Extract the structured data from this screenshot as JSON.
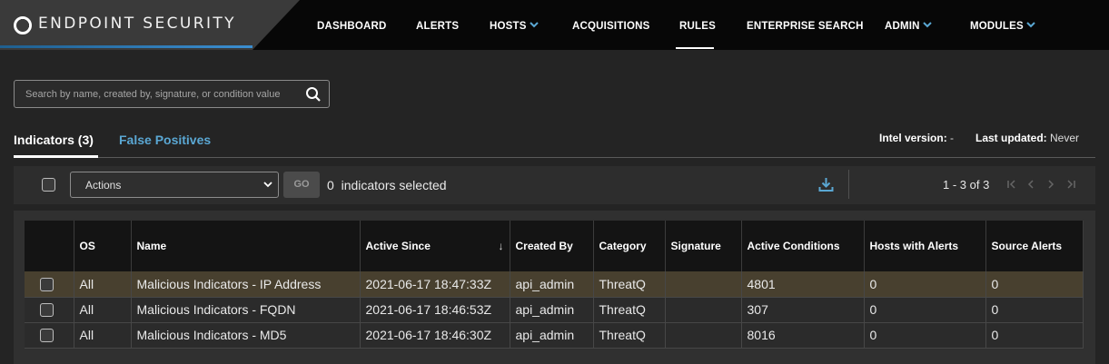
{
  "app": {
    "logo_text": "ENDPOINT SECURITY"
  },
  "nav": {
    "items": [
      {
        "label": "DASHBOARD",
        "dropdown": false
      },
      {
        "label": "ALERTS",
        "dropdown": false
      },
      {
        "label": "HOSTS",
        "dropdown": true
      },
      {
        "label": "ACQUISITIONS",
        "dropdown": false
      },
      {
        "label": "RULES",
        "dropdown": false,
        "active": true
      },
      {
        "label": "ENTERPRISE SEARCH",
        "dropdown": false
      },
      {
        "label": "ADMIN",
        "dropdown": true
      },
      {
        "label": "MODULES",
        "dropdown": true
      }
    ]
  },
  "search": {
    "placeholder": "Search by name, created by, signature, or condition value",
    "value": ""
  },
  "tabs": {
    "indicators_label": "Indicators (3)",
    "false_positives_label": "False Positives"
  },
  "meta": {
    "intel_version_label": "Intel version:",
    "intel_version_value": "-",
    "last_updated_label": "Last updated:",
    "last_updated_value": "Never"
  },
  "toolbar": {
    "actions_label": "Actions",
    "go_label": "GO",
    "selected_count": "0",
    "selected_text": "indicators selected",
    "pager_text": "1 - 3 of 3"
  },
  "table": {
    "headers": [
      "",
      "OS",
      "Name",
      "Active Since",
      "Created By",
      "Category",
      "Signature",
      "Active Conditions",
      "Hosts with Alerts",
      "Source Alerts"
    ],
    "sort_indicator": "↓",
    "rows": [
      [
        "",
        "All",
        "Malicious Indicators - IP Address",
        "2021-06-17 18:47:33Z",
        "api_admin",
        "ThreatQ",
        "",
        "4801",
        "0",
        "0"
      ],
      [
        "",
        "All",
        "Malicious Indicators - FQDN",
        "2021-06-17 18:46:53Z",
        "api_admin",
        "ThreatQ",
        "",
        "307",
        "0",
        "0"
      ],
      [
        "",
        "All",
        "Malicious Indicators - MD5",
        "2021-06-17 18:46:30Z",
        "api_admin",
        "ThreatQ",
        "",
        "8016",
        "0",
        "0"
      ]
    ]
  },
  "colors": {
    "accent_blue": "#5aa7d3",
    "header_bg": "#070707",
    "row_highlight": "#48402f"
  }
}
